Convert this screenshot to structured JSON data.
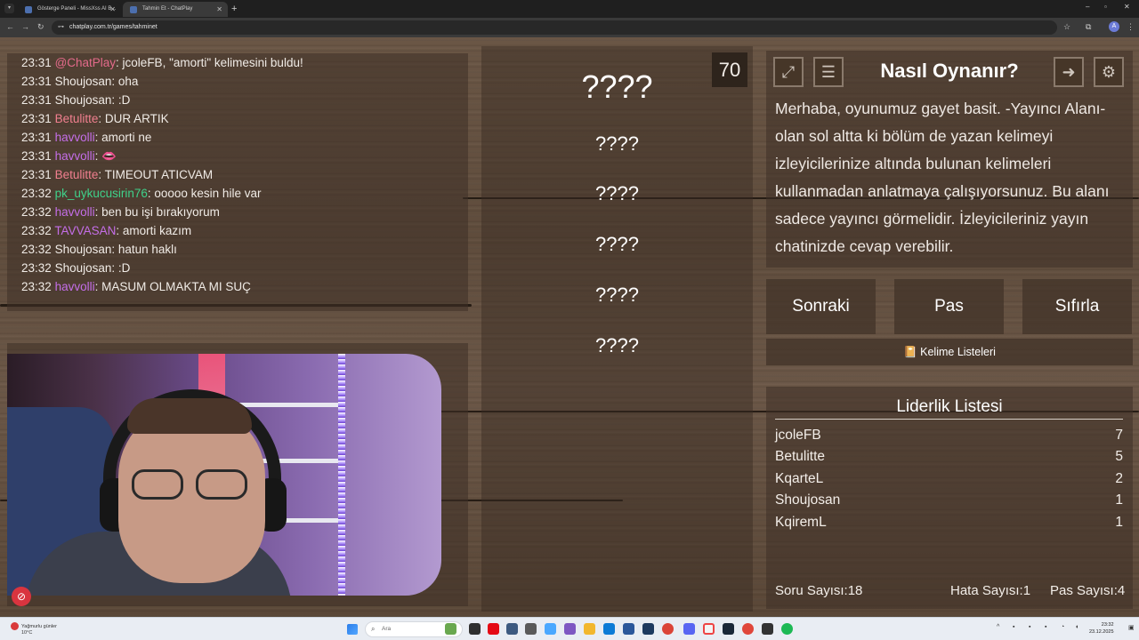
{
  "browser": {
    "tabs": [
      {
        "title": "Gösterge Paneli - MissXss AI B..."
      },
      {
        "title": "Tahmin Et - ChatPlay"
      }
    ],
    "url": "chatplay.com.tr/games/tahminet"
  },
  "chat": {
    "messages": [
      {
        "time": "23:31",
        "user": "@ChatPlay",
        "color": "#e36a8a",
        "text": ": jcoleFB, \"amorti\" kelimesini buldu!"
      },
      {
        "time": "23:31",
        "user": "Shoujosan",
        "color": "#f0ebe6",
        "text": ": oha"
      },
      {
        "time": "23:31",
        "user": "Shoujosan",
        "color": "#f0ebe6",
        "text": ": :D"
      },
      {
        "time": "23:31",
        "user": "Betulitte",
        "color": "#f07f8f",
        "text": ": DUR ARTIK"
      },
      {
        "time": "23:31",
        "user": "havvolli",
        "color": "#c46ee8",
        "text": ": amorti ne"
      },
      {
        "time": "23:31",
        "user": "havvolli",
        "color": "#c46ee8",
        "text": ": 👄"
      },
      {
        "time": "23:31",
        "user": "Betulitte",
        "color": "#f07f8f",
        "text": ": TIMEOUT ATICVAM"
      },
      {
        "time": "23:32",
        "user": "pk_uykucusirin76",
        "color": "#3fd18a",
        "text": ": ooooo kesin hile var"
      },
      {
        "time": "23:32",
        "user": "havvolli",
        "color": "#c46ee8",
        "text": ": ben bu işi bırakıyorum"
      },
      {
        "time": "23:32",
        "user": "TAVVASAN",
        "color": "#c46ee8",
        "text": ": amorti kazım"
      },
      {
        "time": "23:32",
        "user": "Shoujosan",
        "color": "#f0ebe6",
        "text": ": hatun haklı"
      },
      {
        "time": "23:32",
        "user": "Shoujosan",
        "color": "#f0ebe6",
        "text": ": :D"
      },
      {
        "time": "23:32",
        "user": "havvolli",
        "color": "#c46ee8",
        "text": ": MASUM OLMAKTA MI SUÇ"
      }
    ]
  },
  "game": {
    "timer": "70",
    "main_word": "????",
    "forbidden_words": [
      "????",
      "????",
      "????",
      "????",
      "????"
    ]
  },
  "info": {
    "title": "Nasıl Oynanır?",
    "text": "Merhaba, oyunumuz gayet basit. -Yayıncı Alanı- olan sol altta ki bölüm de yazan kelimeyi izleyicilerinize altında bulunan kelimeleri kullanmadan anlatmaya çalışıyorsunuz. Bu alanı sadece yayıncı görmelidir. İzleyicileriniz yayın chatinizde cevap verebilir."
  },
  "buttons": {
    "next": "Sonraki",
    "pass": "Pas",
    "reset": "Sıfırla",
    "word_lists": "Kelime Listeleri"
  },
  "leaderboard": {
    "title": "Liderlik Listesi",
    "rows": [
      {
        "name": "jcoleFB",
        "score": "7"
      },
      {
        "name": "Betulitte",
        "score": "5"
      },
      {
        "name": "KqarteL",
        "score": "2"
      },
      {
        "name": "Shoujosan",
        "score": "1"
      },
      {
        "name": "KqiremL",
        "score": "1"
      }
    ],
    "question_count_label": "Soru Sayısı:",
    "question_count": "18",
    "error_count_label": "Hata Sayısı:",
    "error_count": "1",
    "pass_count_label": "Pas Sayısı:",
    "pass_count": "4"
  },
  "taskbar": {
    "weather_line1": "Yağmurlu günler",
    "weather_line2": "10°C",
    "search_placeholder": "Ara",
    "time": "23:32",
    "date": "23.12.2025"
  },
  "icons": {
    "fullscreen": "fullscreen-icon",
    "document": "document-icon",
    "exit": "exit-icon",
    "settings": "gear-icon"
  }
}
